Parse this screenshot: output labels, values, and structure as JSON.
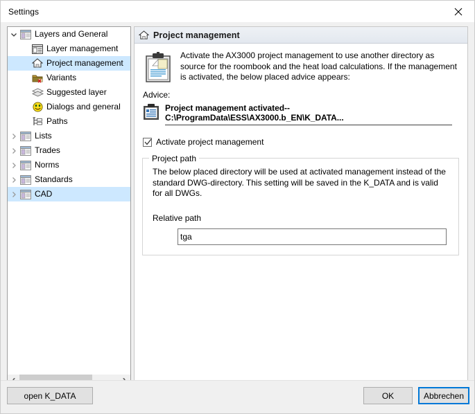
{
  "window": {
    "title": "Settings",
    "close_icon": "close-icon"
  },
  "tree": {
    "items": [
      {
        "label": "Layers and General",
        "level": 0,
        "expander": "chevron-down",
        "icon": "window-list-icon",
        "selected": false
      },
      {
        "label": "Layer management",
        "level": 1,
        "expander": "none",
        "icon": "layer-window-icon",
        "selected": false
      },
      {
        "label": "Project management",
        "level": 1,
        "expander": "none",
        "icon": "house-icon",
        "selected": true
      },
      {
        "label": "Variants",
        "level": 1,
        "expander": "none",
        "icon": "folder-delete-icon",
        "selected": false
      },
      {
        "label": "Suggested layer",
        "level": 1,
        "expander": "none",
        "icon": "stack-layers-icon",
        "selected": false
      },
      {
        "label": "Dialogs and general",
        "level": 1,
        "expander": "none",
        "icon": "smiley-icon",
        "selected": false
      },
      {
        "label": "Paths",
        "level": 1,
        "expander": "none",
        "icon": "tree-paths-icon",
        "selected": false
      },
      {
        "label": "Lists",
        "level": 0,
        "expander": "chevron-right",
        "icon": "window-list-icon",
        "selected": false
      },
      {
        "label": "Trades",
        "level": 0,
        "expander": "chevron-right",
        "icon": "window-list-icon",
        "selected": false
      },
      {
        "label": "Norms",
        "level": 0,
        "expander": "chevron-right",
        "icon": "window-list-icon",
        "selected": false
      },
      {
        "label": "Standards",
        "level": 0,
        "expander": "chevron-right",
        "icon": "window-list-icon",
        "selected": false
      },
      {
        "label": "CAD",
        "level": 0,
        "expander": "chevron-right",
        "icon": "window-list-icon",
        "selected": true
      }
    ],
    "scrollbar": {
      "left_arrow": "❮",
      "right_arrow": "❯"
    }
  },
  "detail": {
    "header_title": "Project management",
    "header_icon": "house-icon",
    "intro_icon": "clipboard-icon",
    "intro_text": "Activate the AX3000 project management to use another directory as source for the roombook and the heat load calculations. If the management is  activated, the below placed advice appears:",
    "advice_label": "Advice:",
    "advice_icon": "clipboard-small-icon",
    "advice_text": "Project management activated--C:\\ProgramData\\ESS\\AX3000.b_EN\\K_DATA...",
    "checkbox": {
      "label": "Activate project management",
      "checked": true
    },
    "groupbox": {
      "title": "Project path",
      "description": "The below placed directory will be used at activated management instead of the standard DWG-directory. This setting will be saved in the K_DATA and is valid for all DWGs.",
      "relative_label": "Relative path",
      "input_value": "tga",
      "input_placeholder": ""
    }
  },
  "footer": {
    "open_kdata_label": "open K_DATA",
    "ok_label": "OK",
    "cancel_label": "Abbrechen"
  },
  "colors": {
    "selection": "#cde8ff",
    "accent": "#0078d7",
    "panel_bg": "#f0f0f0",
    "header_gradient_top": "#eef1f5",
    "header_gradient_bottom": "#e3e8ef"
  }
}
